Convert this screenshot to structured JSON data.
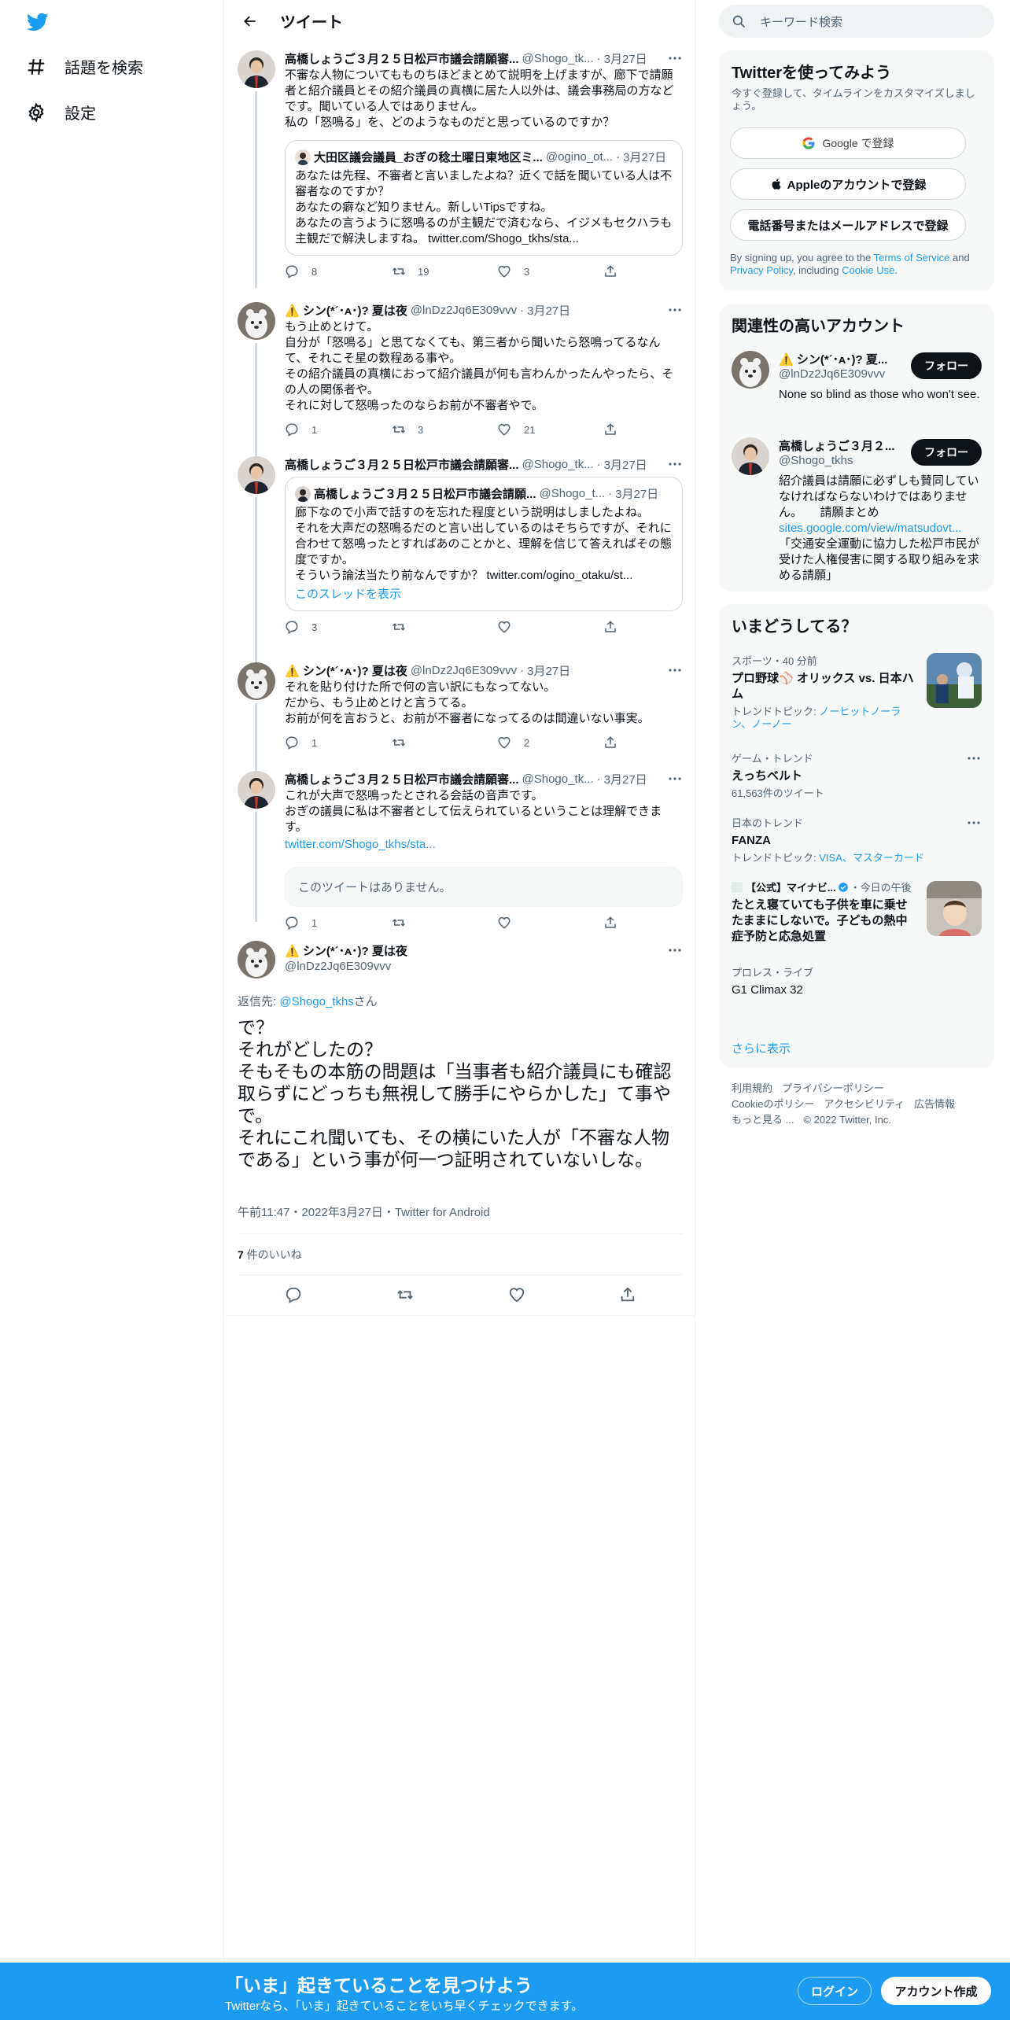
{
  "nav": {
    "explore": "話題を検索",
    "settings": "設定"
  },
  "header": {
    "title": "ツイート"
  },
  "thread": [
    {
      "name": "高橋しょうご３月２５日松戸市議会請願審...",
      "handle": "@Shogo_tk...",
      "date": "3月27日",
      "text": "不審な人物についてもものちほどまとめて説明を上げますが、廊下で請願者と紹介議員とその紹介議員の真横に居た人以外は、議会事務局の方などです。聞いている人ではありません。\n私の「怒鳴る」を、どのようなものだと思っているのですか？",
      "quote": {
        "name": "大田区議会議員_おぎの稔土曜日東地区ミ...",
        "handle": "@ogino_ot...",
        "date": "3月27日",
        "text": "あなたは先程、不審者と言いましたよね？近くで話を聞いている人は不審者なのですか？\nあなたの癖など知りません。新しいTipsですね。\nあなたの言うように怒鳴るのが主観だで済むなら、イジメもセクハラも主観だで解決しますね。 twitter.com/Shogo_tkhs/sta..."
      },
      "replies": "8",
      "retweets": "19",
      "likes": "3"
    },
    {
      "name": "⚠️ シン(*´･ᴀ･)? 夏は夜",
      "handle": "@lnDz2Jq6E309vvv",
      "date": "3月27日",
      "text": "もう止めとけて。\n自分が「怒鳴る」と思てなくても、第三者から聞いたら怒鳴ってるなんて、それこそ星の数程ある事や。\nその紹介議員の真横におって紹介議員が何も言わんかったんやったら、その人の関係者や。\nそれに対して怒鳴ったのならお前が不審者やで。",
      "replies": "1",
      "retweets": "3",
      "likes": "21"
    },
    {
      "name": "高橋しょうご３月２５日松戸市議会請願審...",
      "handle": "@Shogo_tk...",
      "date": "3月27日",
      "text": "",
      "quote": {
        "name": "高橋しょうご３月２５日松戸市議会請願...",
        "handle": "@Shogo_t...",
        "date": "3月27日",
        "text": "廊下なので小声で話すのを忘れた程度という説明はしましたよね。\nそれを大声だの怒鳴るだのと言い出しているのはそちらですが、それに合わせて怒鳴ったとすればあのことかと、理解を信じて答えればその態度ですか。\nそういう論法当たり前なんですか？ twitter.com/ogino_otaku/st...",
        "show_thread": "このスレッドを表示"
      },
      "replies": "3",
      "retweets": "",
      "likes": ""
    },
    {
      "name": "⚠️ シン(*´･ᴀ･)? 夏は夜",
      "handle": "@lnDz2Jq6E309vvv",
      "date": "3月27日",
      "text": "それを貼り付けた所で何の言い訳にもなってない。\nだから、もう止めとけと言うてる。\nお前が何を言おうと、お前が不審者になってるのは間違いない事実。",
      "replies": "1",
      "retweets": "",
      "likes": "2"
    },
    {
      "name": "高橋しょうご３月２５日松戸市議会請願審...",
      "handle": "@Shogo_tk...",
      "date": "3月27日",
      "text": "これが大声で怒鳴ったとされる会話の音声です。\nおぎの議員に私は不審者として伝えられているということは理解できます。",
      "link": "twitter.com/Shogo_tkhs/sta...",
      "unavailable": "このツイートはありません。",
      "replies": "1",
      "retweets": "",
      "likes": ""
    }
  ],
  "main_tweet": {
    "name": "⚠️ シン(*´･ᴀ･)? 夏は夜",
    "handle": "@lnDz2Jq6E309vvv",
    "reply_prefix": "返信先: ",
    "reply_to": "@Shogo_tkhs",
    "reply_suffix": "さん",
    "text": "で？\nそれがどしたの？\nそもそもの本筋の問題は「当事者も紹介議員にも確認取らずにどっちも無視して勝手にやらかした」て事やで。\nそれにこれ聞いても、その横にいた人が「不審な人物である」という事が何一つ証明されていないしな。",
    "meta": "午前11:47・2022年3月27日・Twitter for Android",
    "like_count": "7",
    "like_label": " 件のいいね"
  },
  "search": {
    "placeholder": "キーワード検索"
  },
  "signup": {
    "title": "Twitterを使ってみよう",
    "subtitle": "今すぐ登録して、タイムラインをカスタマイズしましょう。",
    "google": "Google で登録",
    "apple": "Appleのアカウントで登録",
    "phone": "電話番号またはメールアドレスで登録",
    "legal_1": "By signing up, you agree to the ",
    "terms": "Terms of Service",
    "legal_2": " and ",
    "privacy": "Privacy Policy",
    "legal_3": ", including ",
    "cookie": "Cookie Use",
    "legal_4": "."
  },
  "related": {
    "title": "関連性の高いアカウント",
    "follow": "フォロー",
    "accounts": [
      {
        "name": "⚠️ シン(*´･ᴀ･)? 夏...",
        "handle": "@lnDz2Jq6E309vvv",
        "bio": "None so blind as those who won't see."
      },
      {
        "name": "高橋しょうご３月２...",
        "handle": "@Shogo_tkhs",
        "bio_1": "紹介議員は請願に必ずしも賛同していなければならないわけではありません。　　請願まとめ",
        "bio_link": "sites.google.com/view/matsudovt...",
        "bio_2": "「交通安全運動に協力した松戸市民が受けた人権侵害に関する取り組みを求める請願」"
      }
    ]
  },
  "trends": {
    "title": "いまどうしてる？",
    "items": [
      {
        "meta": "スポーツ・40 分前",
        "title": "プロ野球⚾ オリックス vs. 日本ハム",
        "sub_prefix": "トレンドトピック: ",
        "sub_links": "ノーヒットノーラン、ノーノー"
      },
      {
        "meta": "ゲーム・トレンド",
        "title": "えっちベルト",
        "sub": "61,563件のツイート"
      },
      {
        "meta": "日本のトレンド",
        "title": "FANZA",
        "sub_prefix": "トレンドトピック: ",
        "sub_links": "VISA、マスターカード"
      },
      {
        "meta_name": "【公式】マイナビ...",
        "meta_time": "・今日の午後",
        "title": "たとえ寝ていても子供を車に乗せたままにしないで。子どもの熱中症予防と応急処置"
      },
      {
        "meta": "プロレス・ライブ",
        "title": "G1 Climax 32"
      }
    ],
    "more": "さらに表示"
  },
  "footer": {
    "terms": "利用規約",
    "privacy": "プライバシーポリシー",
    "cookies": "Cookieのポリシー",
    "accessibility": "アクセシビリティ",
    "ads": "広告情報",
    "more": "もっと見る ...",
    "copyright": "© 2022 Twitter, Inc."
  },
  "bottom_bar": {
    "title": "「いま」起きていることを見つけよう",
    "subtitle": "Twitterなら、「いま」起きていることをいち早くチェックできます。",
    "login": "ログイン",
    "signup": "アカウント作成"
  },
  "colors": {
    "accent": "#1d9bf0",
    "text": "#0f1419",
    "muted": "#536471"
  }
}
